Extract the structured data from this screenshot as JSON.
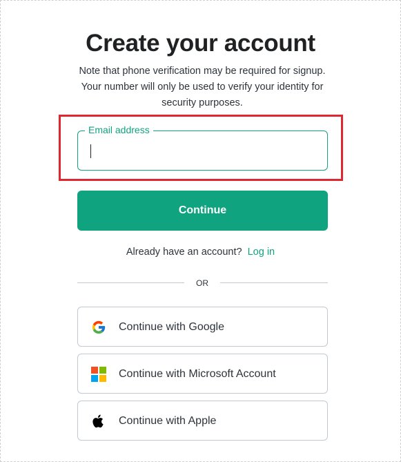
{
  "page": {
    "title": "Create your account",
    "subtitle": "Note that phone verification may be required for signup. Your number will only be used to verify your identity for security purposes."
  },
  "email_field": {
    "label": "Email address",
    "value": ""
  },
  "continue_button": {
    "label": "Continue"
  },
  "login_prompt": {
    "text": "Already have an account?",
    "link": "Log in"
  },
  "divider": {
    "text": "OR"
  },
  "social_buttons": [
    {
      "label": "Continue with Google",
      "icon": "google-icon"
    },
    {
      "label": "Continue with Microsoft Account",
      "icon": "microsoft-icon"
    },
    {
      "label": "Continue with Apple",
      "icon": "apple-icon"
    }
  ],
  "colors": {
    "accent": "#10a37f",
    "highlight_box": "#e0262e",
    "border": "#c2c8d0",
    "text": "#2d333a",
    "heading": "#202123"
  }
}
